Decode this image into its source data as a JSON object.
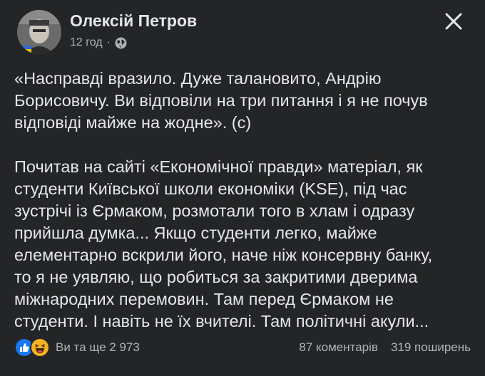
{
  "post": {
    "author": "Олексій Петров",
    "time": "12 год",
    "separator": "·",
    "privacy_icon": "globe-icon",
    "close_icon": "close-icon"
  },
  "body": {
    "paragraph1_lines": [
      "«Насправді вразило. Дуже талановито, Андрію",
      "Борисовичу. Ви відповіли на три питання і я не почув",
      "відповіді майже на жодне». (с)"
    ],
    "paragraph2_lines": [
      "Почитав на сайті «Економічної правди» матеріал, як",
      "студенти Київської школи економіки (KSE), під час",
      "зустрічі із Єрмаком, розмотали того в хлам і одразу",
      "прийшла думка... Якщо студенти легко, майже",
      "елементарно вскрили його, наче ніж консервну банку,",
      "то я не уявляю, що робиться за закритими дверима",
      "міжнародних перемовин. Там перед Єрмаком не",
      "студенти. І навіть не їх вчителі. Там політичні акули..."
    ]
  },
  "footer": {
    "reactions_text": "Ви та ще 2 973",
    "comments": "87 коментарів",
    "shares": "319 поширень",
    "reaction_icons": [
      "like-icon",
      "haha-icon"
    ]
  },
  "colors": {
    "background": "#242526",
    "text": "#e4e6eb",
    "secondary_text": "#b0b3b8",
    "like_blue": "#1877f2",
    "haha_yellow": "#f7b125"
  }
}
